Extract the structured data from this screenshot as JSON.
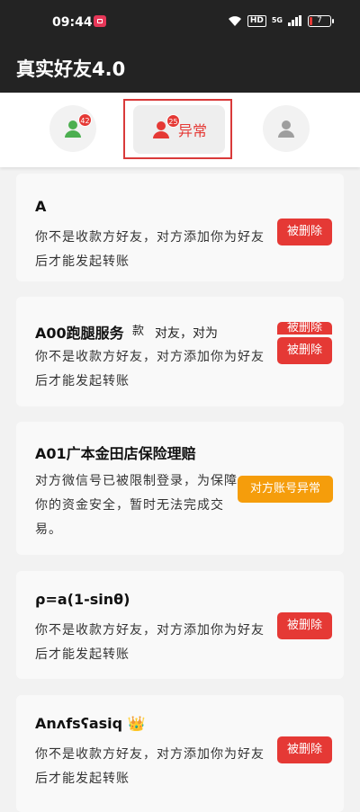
{
  "status_bar": {
    "time": "09:44",
    "hd": "HD",
    "network": "5G",
    "battery": "7"
  },
  "app": {
    "title": "真实好友4.0"
  },
  "tabs": [
    {
      "badge": "42",
      "color": "#4caf50"
    },
    {
      "badge": "25",
      "label": "异常",
      "color": "#e53935"
    },
    {
      "color": "#9e9e9e"
    }
  ],
  "items": [
    {
      "name": "A",
      "message": "你不是收款方好友，对方添加你为好友后才能发起转账",
      "action": "被删除"
    },
    {
      "name": "A00跑腿服务",
      "message": "你不是收款方好友，对方添加你为好友后才能发起转账",
      "action": "被删除",
      "ghost_text": "款",
      "ghost_text2": "对友，对为",
      "ghost_action": "被删除"
    },
    {
      "name": "A01广本金田店保险理赔",
      "message": "对方微信号已被限制登录，为保障你的资金安全，暂时无法完成交易。",
      "action": "对方账号异常"
    },
    {
      "name": "ρ=a(1-sinθ)",
      "message": "你不是收款方好友，对方添加你为好友后才能发起转账",
      "action": "被删除"
    },
    {
      "name": "Anʌfsʕasiq 👑",
      "message": "你不是收款方好友，对方添加你为好友后才能发起转账",
      "action": "被删除"
    }
  ],
  "colors": {
    "danger": "#e53935",
    "warning": "#f59d0b",
    "header": "#232323"
  }
}
